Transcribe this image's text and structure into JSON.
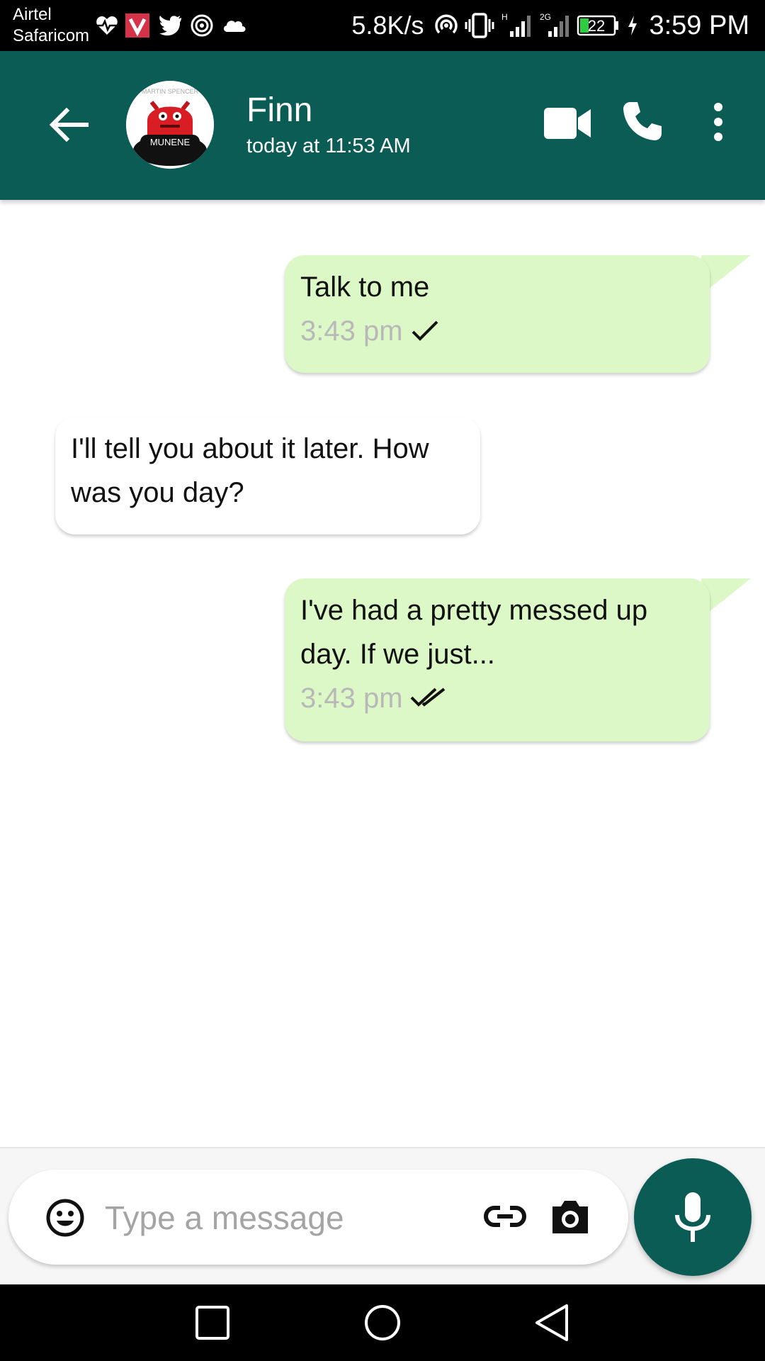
{
  "status_bar": {
    "carrier_line1": "Airtel",
    "carrier_line2": "Safaricom",
    "network_speed": "5.8K/s",
    "network_type_1": "H",
    "network_type_2": "2G",
    "battery": "22",
    "time": "3:59 PM",
    "icons": [
      "heart-pulse-icon",
      "vidmate-icon",
      "twitter-icon",
      "hotspot-icon",
      "cloud-icon",
      "wifi-hotspot-icon",
      "vibrate-icon",
      "signal-icon",
      "battery-icon",
      "charging-icon"
    ]
  },
  "header": {
    "contact_name": "Finn",
    "last_seen": "today at 11:53 AM",
    "avatar_text": "MUNENE",
    "icons": [
      "back-arrow-icon",
      "video-call-icon",
      "phone-icon",
      "more-vert-icon"
    ]
  },
  "messages": [
    {
      "direction": "out",
      "text": "Talk to me",
      "time": "3:43 pm",
      "status": "sent"
    },
    {
      "direction": "in",
      "text": "I'll tell you about it later. How was you day?"
    },
    {
      "direction": "out",
      "text": "I've had a pretty messed up day. If we just...",
      "time": "3:43 pm",
      "status": "delivered"
    }
  ],
  "composer": {
    "placeholder": "Type a message",
    "value": "",
    "icons": [
      "emoji-icon",
      "attach-link-icon",
      "camera-icon",
      "mic-icon"
    ]
  },
  "nav": {
    "icons": [
      "recent-apps-icon",
      "home-icon",
      "back-icon"
    ]
  },
  "colors": {
    "app_bar": "#0b5c54",
    "outgoing_bubble": "#dcf8c6",
    "incoming_bubble": "#ffffff",
    "timestamp": "#b8b8b8"
  }
}
